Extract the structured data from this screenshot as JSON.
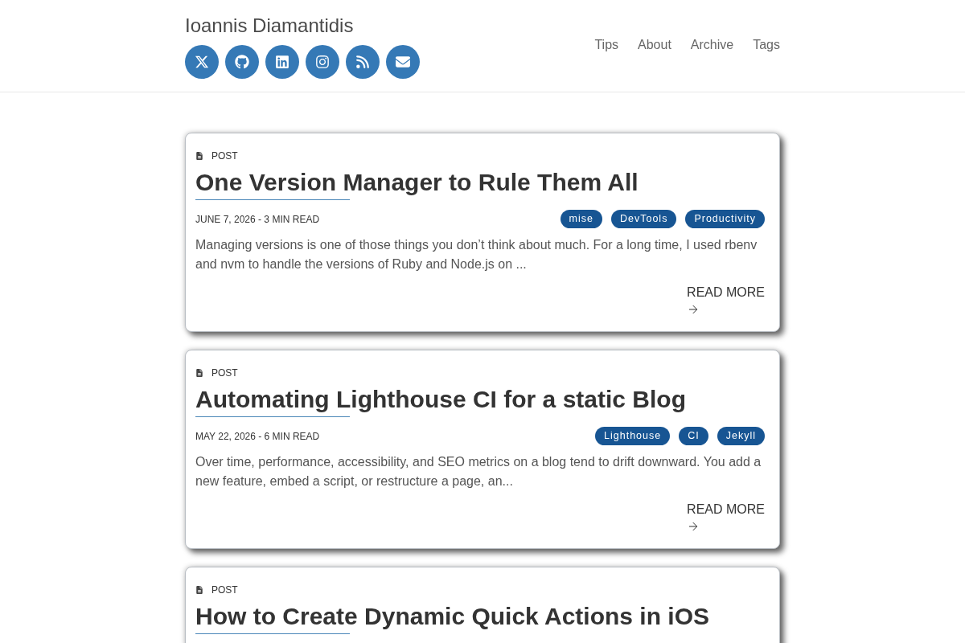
{
  "header": {
    "site_title": "Ioannis Diamantidis",
    "social_links": [
      {
        "kind": "x"
      },
      {
        "kind": "github"
      },
      {
        "kind": "linkedin"
      },
      {
        "kind": "instagram"
      },
      {
        "kind": "rss"
      },
      {
        "kind": "email"
      }
    ],
    "nav": [
      "Tips",
      "About",
      "Archive",
      "Tags"
    ]
  },
  "posts": [
    {
      "category": "POST",
      "title": "One Version Manager to Rule Them All",
      "meta": "JUNE 7, 2026 - 3 MIN READ",
      "tags": [
        "mise",
        "DevTools",
        "Productivity"
      ],
      "excerpt": "Managing versions is one of those things you don’t think about much. For a long time, I used rbenv and nvm to handle the versions of Ruby and Node.js on ...",
      "read_more": "READ MORE"
    },
    {
      "category": "POST",
      "title": "Automating Lighthouse CI for a static Blog",
      "meta": "MAY 22, 2026 - 6 MIN READ",
      "tags": [
        "Lighthouse",
        "CI",
        "Jekyll"
      ],
      "excerpt": "Over time, performance, accessibility, and SEO metrics on a blog tend to drift downward. You add a new feature, embed a script, or restructure a page, an...",
      "read_more": "READ MORE"
    },
    {
      "category": "POST",
      "title": "How to Create Dynamic Quick Actions in iOS"
    }
  ]
}
